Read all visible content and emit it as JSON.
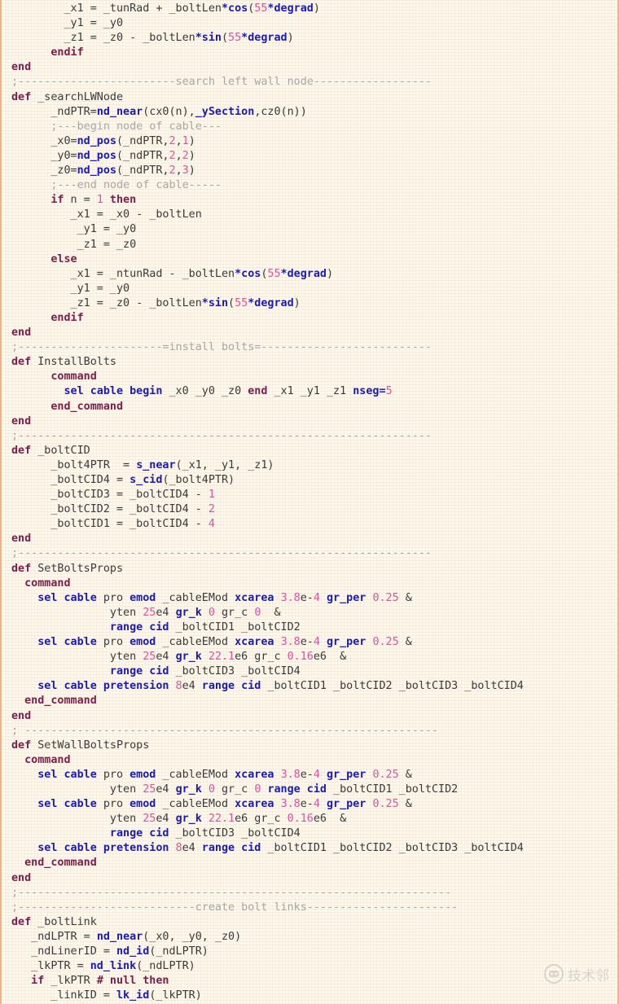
{
  "colors": {
    "background": "#fff8ec",
    "border": "#f0b48a",
    "keyword_purple": "#7a1e4a",
    "keyword_blue": "#1a1ab8",
    "number_pink": "#e0529c",
    "comment_gray": "#a6a6a6",
    "plain_text": "#3a3a3a"
  },
  "watermark": {
    "text": "技术邻",
    "icon": "robot-logo-icon"
  },
  "lines": [
    [
      [
        "        _x1 = _tunRad + _boltLen",
        "tx"
      ],
      [
        "*cos",
        "bl"
      ],
      [
        "(",
        "tx"
      ],
      [
        "55",
        "num"
      ],
      [
        "*degrad",
        "bl"
      ],
      [
        ")",
        "tx"
      ]
    ],
    [
      [
        "        _y1 = _y0",
        "tx"
      ]
    ],
    [
      [
        "        _z1 = _z0 - _boltLen",
        "tx"
      ],
      [
        "*sin",
        "bl"
      ],
      [
        "(",
        "tx"
      ],
      [
        "55",
        "num"
      ],
      [
        "*degrad",
        "bl"
      ],
      [
        ")",
        "tx"
      ]
    ],
    [
      [
        "      endif",
        "kw"
      ]
    ],
    [
      [
        "end",
        "kw"
      ]
    ],
    [
      [
        ";------------------------search left wall node------------------",
        "cm"
      ]
    ],
    [
      [
        "def",
        "kw"
      ],
      [
        " _searchLWNode",
        "tx"
      ]
    ],
    [
      [
        "      _ndPTR=",
        "tx"
      ],
      [
        "nd_near",
        "bl"
      ],
      [
        "(cx0(n),",
        "tx"
      ],
      [
        "_ySection",
        "bl"
      ],
      [
        ",cz0(n))",
        "tx"
      ]
    ],
    [
      [
        "      ;---begin node of cable---",
        "cm"
      ]
    ],
    [
      [
        "      _x0=",
        "tx"
      ],
      [
        "nd_pos",
        "bl"
      ],
      [
        "(_ndPTR,",
        "tx"
      ],
      [
        "2",
        "num"
      ],
      [
        ",",
        "tx"
      ],
      [
        "1",
        "num"
      ],
      [
        ")",
        "tx"
      ]
    ],
    [
      [
        "      _y0=",
        "tx"
      ],
      [
        "nd_pos",
        "bl"
      ],
      [
        "(_ndPTR,",
        "tx"
      ],
      [
        "2",
        "num"
      ],
      [
        ",",
        "tx"
      ],
      [
        "2",
        "num"
      ],
      [
        ")",
        "tx"
      ]
    ],
    [
      [
        "      _z0=",
        "tx"
      ],
      [
        "nd_pos",
        "bl"
      ],
      [
        "(_ndPTR,",
        "tx"
      ],
      [
        "2",
        "num"
      ],
      [
        ",",
        "tx"
      ],
      [
        "3",
        "num"
      ],
      [
        ")",
        "tx"
      ]
    ],
    [
      [
        "      ;---end node of cable-----",
        "cm"
      ]
    ],
    [
      [
        "      if",
        "kw"
      ],
      [
        " n = ",
        "tx"
      ],
      [
        "1",
        "num"
      ],
      [
        " then",
        "kw"
      ]
    ],
    [
      [
        "         _x1 = _x0 - _boltLen",
        "tx"
      ]
    ],
    [
      [
        "          _y1 = _y0",
        "tx"
      ]
    ],
    [
      [
        "          _z1 = _z0",
        "tx"
      ]
    ],
    [
      [
        "      else",
        "kw"
      ]
    ],
    [
      [
        "         _x1 = _ntunRad - _boltLen",
        "tx"
      ],
      [
        "*cos",
        "bl"
      ],
      [
        "(",
        "tx"
      ],
      [
        "55",
        "num"
      ],
      [
        "*degrad",
        "bl"
      ],
      [
        ")",
        "tx"
      ]
    ],
    [
      [
        "         _y1 = _y0",
        "tx"
      ]
    ],
    [
      [
        "         _z1 = _z0 - _boltLen",
        "tx"
      ],
      [
        "*sin",
        "bl"
      ],
      [
        "(",
        "tx"
      ],
      [
        "55",
        "num"
      ],
      [
        "*degrad",
        "bl"
      ],
      [
        ")",
        "tx"
      ]
    ],
    [
      [
        "      endif",
        "kw"
      ]
    ],
    [
      [
        "end",
        "kw"
      ]
    ],
    [
      [
        ";----------------------=install bolts=--------------------------",
        "cm"
      ]
    ],
    [
      [
        "def",
        "kw"
      ],
      [
        " InstallBolts",
        "tx"
      ]
    ],
    [
      [
        "      command",
        "kw"
      ]
    ],
    [
      [
        "        sel cable begin",
        "bl"
      ],
      [
        " _x0 _y0 _z0 ",
        "tx"
      ],
      [
        "end",
        "kw"
      ],
      [
        " _x1 _y1 _z1 ",
        "tx"
      ],
      [
        "nseg=",
        "bl"
      ],
      [
        "5",
        "num"
      ]
    ],
    [
      [
        "      end_command",
        "kw"
      ]
    ],
    [
      [
        "end",
        "kw"
      ]
    ],
    [
      [
        ";---------------------------------------------------------------",
        "cm"
      ]
    ],
    [
      [
        "def",
        "kw"
      ],
      [
        " _boltCID",
        "tx"
      ]
    ],
    [
      [
        "      _bolt4PTR  = ",
        "tx"
      ],
      [
        "s_near",
        "bl"
      ],
      [
        "(_x1, _y1, _z1)",
        "tx"
      ]
    ],
    [
      [
        "      _boltCID4 = ",
        "tx"
      ],
      [
        "s_cid",
        "bl"
      ],
      [
        "(_bolt4PTR)",
        "tx"
      ]
    ],
    [
      [
        "      _boltCID3 = _boltCID4 - ",
        "tx"
      ],
      [
        "1",
        "num"
      ]
    ],
    [
      [
        "      _boltCID2 = _boltCID4 - ",
        "tx"
      ],
      [
        "2",
        "num"
      ]
    ],
    [
      [
        "      _boltCID1 = _boltCID4 - ",
        "tx"
      ],
      [
        "4",
        "num"
      ]
    ],
    [
      [
        "end",
        "kw"
      ]
    ],
    [
      [
        ";---------------------------------------------------------------",
        "cm"
      ]
    ],
    [
      [
        "def",
        "kw"
      ],
      [
        " SetBoltsProps",
        "tx"
      ]
    ],
    [
      [
        "  command",
        "kw"
      ]
    ],
    [
      [
        "    sel cable",
        "bl"
      ],
      [
        " pro ",
        "tx"
      ],
      [
        "emod",
        "bl"
      ],
      [
        " _cableEMod ",
        "tx"
      ],
      [
        "xcarea",
        "bl"
      ],
      [
        " ",
        "tx"
      ],
      [
        "3.8",
        "num"
      ],
      [
        "e-",
        "tx"
      ],
      [
        "4",
        "num"
      ],
      [
        " ",
        "tx"
      ],
      [
        "gr_per",
        "bl"
      ],
      [
        " ",
        "tx"
      ],
      [
        "0.25",
        "num"
      ],
      [
        " &",
        "tx"
      ]
    ],
    [
      [
        "               yten ",
        "tx"
      ],
      [
        "25",
        "num"
      ],
      [
        "e4 ",
        "tx"
      ],
      [
        "gr_k",
        "bl"
      ],
      [
        " ",
        "tx"
      ],
      [
        "0",
        "num"
      ],
      [
        " gr_c ",
        "tx"
      ],
      [
        "0",
        "num"
      ],
      [
        "  &",
        "tx"
      ]
    ],
    [
      [
        "               range cid",
        "bl"
      ],
      [
        " _boltCID1 _boltCID2",
        "tx"
      ]
    ],
    [
      [
        "    sel cable",
        "bl"
      ],
      [
        " pro ",
        "tx"
      ],
      [
        "emod",
        "bl"
      ],
      [
        " _cableEMod ",
        "tx"
      ],
      [
        "xcarea",
        "bl"
      ],
      [
        " ",
        "tx"
      ],
      [
        "3.8",
        "num"
      ],
      [
        "e-",
        "tx"
      ],
      [
        "4",
        "num"
      ],
      [
        " ",
        "tx"
      ],
      [
        "gr_per",
        "bl"
      ],
      [
        " ",
        "tx"
      ],
      [
        "0.25",
        "num"
      ],
      [
        " &",
        "tx"
      ]
    ],
    [
      [
        "               yten ",
        "tx"
      ],
      [
        "25",
        "num"
      ],
      [
        "e4 ",
        "tx"
      ],
      [
        "gr_k",
        "bl"
      ],
      [
        " ",
        "tx"
      ],
      [
        "22.1",
        "num"
      ],
      [
        "e6 gr_c ",
        "tx"
      ],
      [
        "0.16",
        "num"
      ],
      [
        "e6  &",
        "tx"
      ]
    ],
    [
      [
        "               range cid",
        "bl"
      ],
      [
        " _boltCID3 _boltCID4",
        "tx"
      ]
    ],
    [
      [
        "    sel cable pretension",
        "bl"
      ],
      [
        " ",
        "tx"
      ],
      [
        "8",
        "num"
      ],
      [
        "e4 ",
        "tx"
      ],
      [
        "range cid",
        "bl"
      ],
      [
        " _boltCID1 _boltCID2 _boltCID3 _boltCID4",
        "tx"
      ]
    ],
    [
      [
        "  end_command",
        "kw"
      ]
    ],
    [
      [
        "end",
        "kw"
      ]
    ],
    [
      [
        "; ---------------------------------------------------------------",
        "cm"
      ]
    ],
    [
      [
        "def",
        "kw"
      ],
      [
        " SetWallBoltsProps",
        "tx"
      ]
    ],
    [
      [
        "  command",
        "kw"
      ]
    ],
    [
      [
        "    sel cable",
        "bl"
      ],
      [
        " pro ",
        "tx"
      ],
      [
        "emod",
        "bl"
      ],
      [
        " _cableEMod ",
        "tx"
      ],
      [
        "xcarea",
        "bl"
      ],
      [
        " ",
        "tx"
      ],
      [
        "3.8",
        "num"
      ],
      [
        "e-",
        "tx"
      ],
      [
        "4",
        "num"
      ],
      [
        " ",
        "tx"
      ],
      [
        "gr_per",
        "bl"
      ],
      [
        " ",
        "tx"
      ],
      [
        "0.25",
        "num"
      ],
      [
        " &",
        "tx"
      ]
    ],
    [
      [
        "               yten ",
        "tx"
      ],
      [
        "25",
        "num"
      ],
      [
        "e4 ",
        "tx"
      ],
      [
        "gr_k",
        "bl"
      ],
      [
        " ",
        "tx"
      ],
      [
        "0",
        "num"
      ],
      [
        " gr_c ",
        "tx"
      ],
      [
        "0",
        "num"
      ],
      [
        " ",
        "tx"
      ],
      [
        "range cid",
        "bl"
      ],
      [
        " _boltCID1 _boltCID2",
        "tx"
      ]
    ],
    [
      [
        "    sel cable",
        "bl"
      ],
      [
        " pro ",
        "tx"
      ],
      [
        "emod",
        "bl"
      ],
      [
        " _cableEMod ",
        "tx"
      ],
      [
        "xcarea",
        "bl"
      ],
      [
        " ",
        "tx"
      ],
      [
        "3.8",
        "num"
      ],
      [
        "e-",
        "tx"
      ],
      [
        "4",
        "num"
      ],
      [
        " ",
        "tx"
      ],
      [
        "gr_per",
        "bl"
      ],
      [
        " ",
        "tx"
      ],
      [
        "0.25",
        "num"
      ],
      [
        " &",
        "tx"
      ]
    ],
    [
      [
        "               yten ",
        "tx"
      ],
      [
        "25",
        "num"
      ],
      [
        "e4 ",
        "tx"
      ],
      [
        "gr_k",
        "bl"
      ],
      [
        " ",
        "tx"
      ],
      [
        "22.1",
        "num"
      ],
      [
        "e6 gr_c ",
        "tx"
      ],
      [
        "0.16",
        "num"
      ],
      [
        "e6  &",
        "tx"
      ]
    ],
    [
      [
        "               range cid",
        "bl"
      ],
      [
        " _boltCID3 _boltCID4",
        "tx"
      ]
    ],
    [
      [
        "    sel cable pretension",
        "bl"
      ],
      [
        " ",
        "tx"
      ],
      [
        "8",
        "num"
      ],
      [
        "e4 ",
        "tx"
      ],
      [
        "range cid",
        "bl"
      ],
      [
        " _boltCID1 _boltCID2 _boltCID3 _boltCID4",
        "tx"
      ]
    ],
    [
      [
        "  end_command",
        "kw"
      ]
    ],
    [
      [
        "end",
        "kw"
      ]
    ],
    [
      [
        ";------------------------------------------------------------------",
        "cm"
      ]
    ],
    [
      [
        ";---------------------------create bolt links-----------------------",
        "cm"
      ]
    ],
    [
      [
        "def",
        "kw"
      ],
      [
        " _boltLink",
        "tx"
      ]
    ],
    [
      [
        "   _ndLPTR = ",
        "tx"
      ],
      [
        "nd_near",
        "bl"
      ],
      [
        "(_x0, _y0, _z0)",
        "tx"
      ]
    ],
    [
      [
        "   _ndLinerID = ",
        "tx"
      ],
      [
        "nd_id",
        "bl"
      ],
      [
        "(_ndLPTR)",
        "tx"
      ]
    ],
    [
      [
        "   _lkPTR = ",
        "tx"
      ],
      [
        "nd_link",
        "bl"
      ],
      [
        "(_ndLPTR)",
        "tx"
      ]
    ],
    [
      [
        "   if",
        "kw"
      ],
      [
        " _lkPTR ",
        "tx"
      ],
      [
        "# null then",
        "kw"
      ]
    ],
    [
      [
        "      _linkID = ",
        "tx"
      ],
      [
        "lk_id",
        "bl"
      ],
      [
        "(_lkPTR)",
        "tx"
      ]
    ]
  ]
}
